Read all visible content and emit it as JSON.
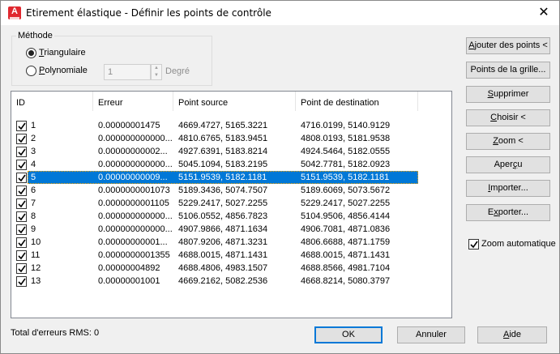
{
  "window": {
    "title": "Etirement élastique - Définir les points de contrôle"
  },
  "method": {
    "group_label": "Méthode",
    "triangular": "Triangulaire",
    "polynomial": "Polynomiale",
    "degree_value": "1",
    "degree_label": "Degré",
    "selected": "triangular"
  },
  "table": {
    "columns": [
      "ID",
      "Erreur",
      "Point source",
      "Point de destination"
    ],
    "selected_row": 4,
    "rows": [
      {
        "id": "1",
        "err": "0.00000001475",
        "src": "4669.4727, 5165.3221",
        "dst": "4716.0199, 5140.9129"
      },
      {
        "id": "2",
        "err": "0.000000000000...",
        "src": "4810.6765, 5183.9451",
        "dst": "4808.0193, 5181.9538"
      },
      {
        "id": "3",
        "err": "0.00000000002...",
        "src": "4927.6391, 5183.8214",
        "dst": "4924.5464, 5182.0555"
      },
      {
        "id": "4",
        "err": "0.000000000000...",
        "src": "5045.1094, 5183.2195",
        "dst": "5042.7781, 5182.0923"
      },
      {
        "id": "5",
        "err": "0.00000000009...",
        "src": "5151.9539, 5182.1181",
        "dst": "5151.9539, 5182.1181"
      },
      {
        "id": "6",
        "err": "0.0000000001073",
        "src": "5189.3436, 5074.7507",
        "dst": "5189.6069, 5073.5672"
      },
      {
        "id": "7",
        "err": "0.0000000001105",
        "src": "5229.2417, 5027.2255",
        "dst": "5229.2417, 5027.2255"
      },
      {
        "id": "8",
        "err": "0.000000000000...",
        "src": "5106.0552, 4856.7823",
        "dst": "5104.9506, 4856.4144"
      },
      {
        "id": "9",
        "err": "0.000000000000...",
        "src": "4907.9866, 4871.1634",
        "dst": "4906.7081, 4871.0836"
      },
      {
        "id": "10",
        "err": "0.00000000001...",
        "src": "4807.9206, 4871.3231",
        "dst": "4806.6688, 4871.1759"
      },
      {
        "id": "11",
        "err": "0.0000000001355",
        "src": "4688.0015, 4871.1431",
        "dst": "4688.0015, 4871.1431"
      },
      {
        "id": "12",
        "err": "0.00000004892",
        "src": "4688.4806, 4983.1507",
        "dst": "4688.8566, 4981.7104"
      },
      {
        "id": "13",
        "err": "0.00000001001",
        "src": "4669.2162, 5082.2536",
        "dst": "4668.8214, 5080.3797"
      }
    ]
  },
  "buttons": {
    "add_points": "Ajouter des points <",
    "grid_points": "Points de la grille...",
    "delete": "Supprimer",
    "choose": "Choisir <",
    "zoom": "Zoom <",
    "preview": "Aperçu",
    "import": "Importer...",
    "export": "Exporter...",
    "ok": "OK",
    "cancel": "Annuler",
    "help": "Aide"
  },
  "auto_zoom": {
    "label": "Zoom automatique",
    "checked": true
  },
  "rms": {
    "label": "Total d'erreurs RMS:",
    "value": "0"
  },
  "colors": {
    "selection": "#0078d7",
    "accent": "#e0282f"
  },
  "icons": {
    "app": "autocad-icon",
    "close": "close-icon",
    "check": "checkmark-icon"
  }
}
